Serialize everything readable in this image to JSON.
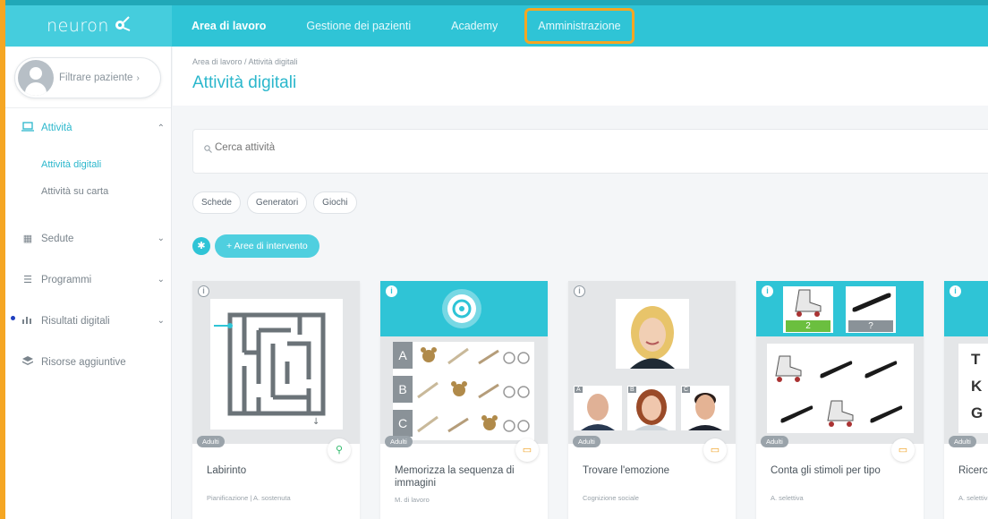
{
  "app": {
    "logo": "neuron"
  },
  "nav": {
    "items": [
      {
        "label": "Area di lavoro"
      },
      {
        "label": "Gestione dei pazienti"
      },
      {
        "label": "Academy"
      },
      {
        "label": "Amministrazione"
      }
    ]
  },
  "sidebar": {
    "patient_filter": {
      "label": "Filtrare paziente"
    },
    "groups": [
      {
        "label": "Attività",
        "icon": "laptop-icon",
        "expanded": true
      },
      {
        "label": "Sedute",
        "icon": "table-icon"
      },
      {
        "label": "Programmi",
        "icon": "list-icon"
      },
      {
        "label": "Risultati digitali",
        "icon": "bar-chart-icon"
      },
      {
        "label": "Risorse aggiuntive",
        "icon": "layers-icon"
      }
    ],
    "sub_items": [
      {
        "label": "Attività digitali"
      },
      {
        "label": "Attività su carta"
      }
    ]
  },
  "main": {
    "breadcrumb": "Area di lavoro / Attività digitali",
    "title": "Attività digitali",
    "search": {
      "placeholder": "Cerca attività"
    },
    "chips": [
      {
        "label": "Schede"
      },
      {
        "label": "Generatori"
      },
      {
        "label": "Giochi"
      }
    ],
    "areas_button": "+ Aree di intervento"
  },
  "cards": [
    {
      "title": "Labirinto",
      "meta": "Pianificazione | A. sostenuta",
      "badge": "Adulti",
      "type_icon": "gamepad-icon"
    },
    {
      "title": "Memorizza la sequenza di immagini",
      "meta": "M. di lavoro",
      "badge": "Adulti",
      "type_icon": "calendar-icon",
      "rows": [
        "A",
        "B",
        "C"
      ]
    },
    {
      "title": "Trovare l'emozione",
      "meta": "Cognizione sociale",
      "badge": "Adulti",
      "type_icon": "calendar-icon",
      "options": [
        "A",
        "B",
        "C"
      ]
    },
    {
      "title": "Conta gli stimoli per tipo",
      "meta": "A. selettiva",
      "badge": "Adulti",
      "type_icon": "calendar-icon",
      "count_a": "2",
      "count_b": "?"
    },
    {
      "title": "Ricerc",
      "meta": "A. selettiva",
      "badge": "Adulti",
      "letters": [
        "T",
        "K",
        "G"
      ]
    }
  ],
  "colors": {
    "accent": "#2fc4d6",
    "highlight": "#F5A623"
  }
}
